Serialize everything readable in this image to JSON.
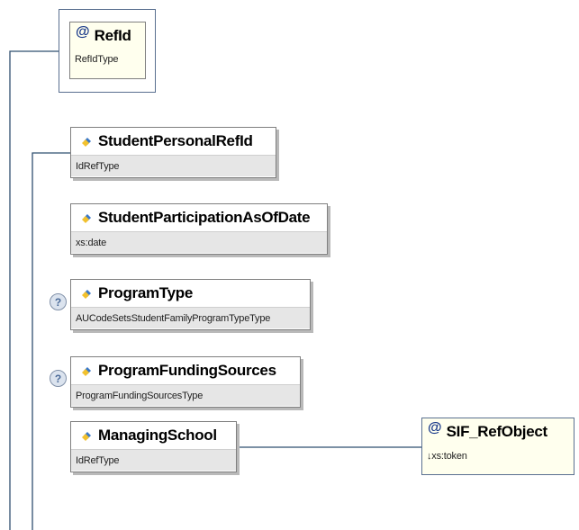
{
  "nodes": {
    "refid": {
      "name": "RefId",
      "type": "RefIdType",
      "icon": "attribute-icon",
      "marker": "@"
    },
    "student_personal_refid": {
      "name": "StudentPersonalRefId",
      "type": "IdRefType",
      "icon": "element-icon"
    },
    "student_participation_as_of_date": {
      "name": "StudentParticipationAsOfDate",
      "type": "xs:date",
      "icon": "element-icon"
    },
    "program_type": {
      "name": "ProgramType",
      "type": "AUCodeSetsStudentFamilyProgramTypeType",
      "icon": "element-icon",
      "optional_marker": "?"
    },
    "program_funding_sources": {
      "name": "ProgramFundingSources",
      "type": "ProgramFundingSourcesType",
      "icon": "element-icon",
      "optional_marker": "?"
    },
    "managing_school": {
      "name": "ManagingSchool",
      "type": "IdRefType",
      "icon": "element-icon"
    },
    "sif_refobject": {
      "name": "SIF_RefObject",
      "type": "↓xs:token",
      "icon": "attribute-icon",
      "marker": "@"
    }
  },
  "colors": {
    "connector": "#2f4f6f",
    "icon_blue": "#3a78c8",
    "icon_yellow": "#f2c12e",
    "type_band": "#e6e6e6",
    "attribute_fill": "#ffffee"
  }
}
